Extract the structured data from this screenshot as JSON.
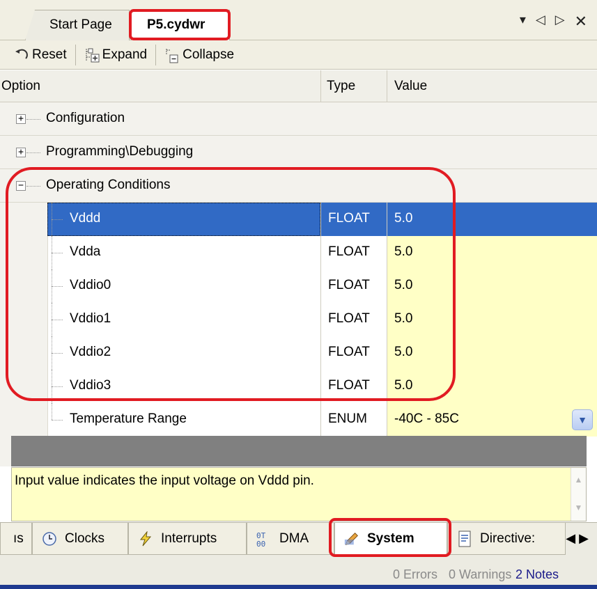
{
  "tabs": {
    "items": [
      {
        "label": "Start Page"
      },
      {
        "label": "P5.cydwr"
      }
    ],
    "controls": {
      "dropdown": "▾",
      "prev": "◁",
      "next": "▷",
      "close": "✕"
    }
  },
  "toolbar": {
    "reset_label": "Reset",
    "expand_label": "Expand",
    "collapse_label": "Collapse"
  },
  "grid": {
    "columns": [
      "Option",
      "Type",
      "Value"
    ],
    "categories": [
      {
        "label": "Configuration",
        "expanded": false
      },
      {
        "label": "Programming\\Debugging",
        "expanded": false
      },
      {
        "label": "Operating Conditions",
        "expanded": true
      }
    ],
    "expander_collapsed": "+",
    "expander_expanded": "−",
    "properties": [
      {
        "name": "Vddd",
        "type": "FLOAT",
        "value": "5.0",
        "selected": true
      },
      {
        "name": "Vdda",
        "type": "FLOAT",
        "value": "5.0"
      },
      {
        "name": "Vddio0",
        "type": "FLOAT",
        "value": "5.0"
      },
      {
        "name": "Vddio1",
        "type": "FLOAT",
        "value": "5.0"
      },
      {
        "name": "Vddio2",
        "type": "FLOAT",
        "value": "5.0"
      },
      {
        "name": "Vddio3",
        "type": "FLOAT",
        "value": "5.0"
      },
      {
        "name": "Temperature Range",
        "type": "ENUM",
        "value": "-40C - 85C"
      }
    ]
  },
  "description": {
    "text": "Input value indicates the input voltage on Vddd pin."
  },
  "bottom_tabs": {
    "items": [
      {
        "label": "ıs",
        "icon": "truncated-tab"
      },
      {
        "label": "Clocks",
        "icon": "clock-icon"
      },
      {
        "label": "Interrupts",
        "icon": "lightning-icon"
      },
      {
        "label": "DMA",
        "icon": "dma-icon"
      },
      {
        "label": "System",
        "icon": "pencil-icon"
      },
      {
        "label": "Directive:",
        "icon": "document-icon"
      }
    ],
    "scroll_left": "◀",
    "scroll_right": "▶"
  },
  "status": {
    "errors": "0 Errors",
    "warnings": "0 Warnings",
    "notes": "2 Notes"
  },
  "colors": {
    "selection": "#316ac5",
    "value_background": "#ffffc6",
    "highlight": "#e11b22"
  }
}
